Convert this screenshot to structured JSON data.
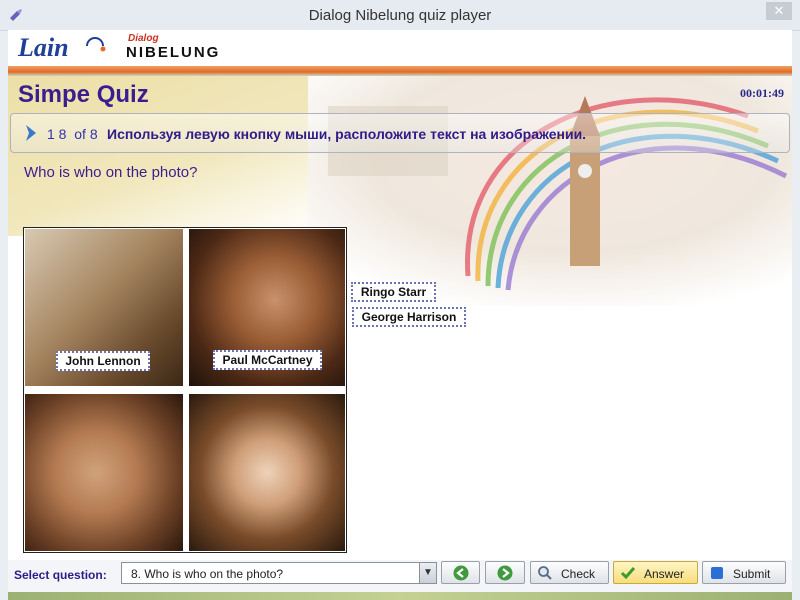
{
  "window": {
    "title": "Dialog Nibelung quiz player",
    "close_icon": "close-icon",
    "app_icon": "pin-icon"
  },
  "header": {
    "logo_lain": "Lain",
    "logo_dialog": "Dialog",
    "logo_nibelung": "NIBELUNG"
  },
  "quiz": {
    "title": "Simpe Quiz",
    "timer": "00:01:49",
    "question_number": "1 8",
    "question_of": "of 8",
    "instruction": "Используя левую кнопку мыши, расположите текст на изображении.",
    "question_text": "Who is who on the photo?"
  },
  "labels": {
    "john": "John Lennon",
    "paul": "Paul McCartney",
    "ringo": "Ringo Starr",
    "george": "George Harrison"
  },
  "footer": {
    "select_label": "Select question:",
    "select_value": "8. Who is who on the photo?",
    "check": "Check",
    "answer": "Answer",
    "submit": "Submit"
  },
  "colors": {
    "accent": "#3b1d8f",
    "stripe": "#e36b28",
    "answer_button": "#f7dd7b"
  }
}
